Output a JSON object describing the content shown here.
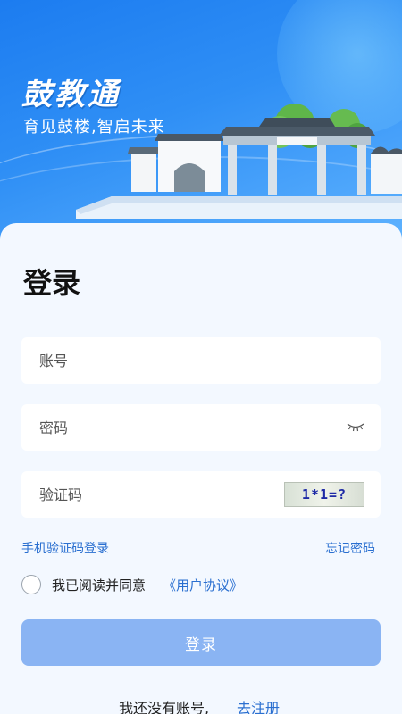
{
  "header": {
    "app_title": "鼓教通",
    "slogan": "育见鼓楼,智启未来"
  },
  "login": {
    "heading": "登录",
    "account_placeholder": "账号",
    "password_placeholder": "密码",
    "captcha_placeholder": "验证码",
    "captcha_text": "1*1=?",
    "sms_login_link": "手机验证码登录",
    "forgot_password_link": "忘记密码",
    "agree_text": "我已阅读并同意",
    "agreement_link": "《用户协议》",
    "login_button": "登录",
    "no_account_text": "我还没有账号,",
    "register_link": "去注册"
  },
  "colors": {
    "hero_blue": "#1c7cf0",
    "link_blue": "#2a6fd0",
    "button_disabled": "#8ab4f3",
    "card_bg": "#f3f8ff"
  },
  "icons": {
    "password_toggle": "eye-closed-icon",
    "agree_checkbox": "radio-circle-icon"
  }
}
